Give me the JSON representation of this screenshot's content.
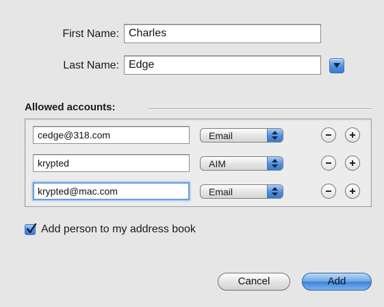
{
  "form": {
    "first_name_label": "First Name:",
    "first_name_value": "Charles",
    "last_name_label": "Last Name:",
    "last_name_value": "Edge"
  },
  "accounts": {
    "section_title": "Allowed accounts:",
    "rows": [
      {
        "address": "cedge@318.com",
        "type": "Email"
      },
      {
        "address": "krypted",
        "type": "AIM"
      },
      {
        "address": "krypted@mac.com",
        "type": "Email"
      }
    ]
  },
  "options": {
    "add_to_address_book_label": "Add person to my address book",
    "add_to_address_book_checked": true
  },
  "buttons": {
    "cancel_label": "Cancel",
    "add_label": "Add"
  },
  "colors": {
    "accent_blue": "#4e8fdb",
    "window_background": "#e6e6e6"
  },
  "icons": {
    "disclosure": "chevron-down-icon",
    "remove": "minus-icon",
    "add": "plus-icon",
    "popup": "up-down-arrows-icon",
    "check": "checkmark-icon"
  }
}
